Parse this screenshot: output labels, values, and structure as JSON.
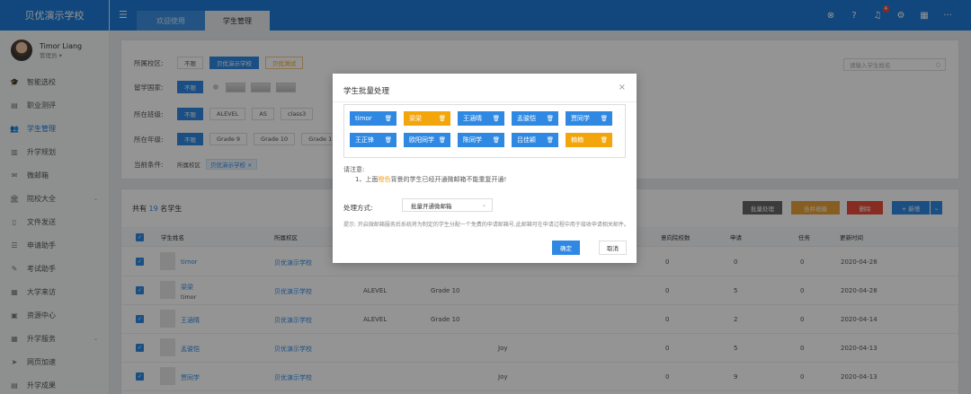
{
  "app": {
    "title": "贝优演示学校"
  },
  "user": {
    "name": "Timor Liang",
    "role": "管理员 ▾"
  },
  "sidebar": {
    "items": [
      {
        "label": "智能选校",
        "icon": "graduation-cap-icon",
        "glyph": "🎓"
      },
      {
        "label": "职业测评",
        "icon": "clipboard-icon",
        "glyph": "▤"
      },
      {
        "label": "学生管理",
        "icon": "users-icon",
        "glyph": "👥",
        "active": true
      },
      {
        "label": "升学规划",
        "icon": "chart-icon",
        "glyph": "▥"
      },
      {
        "label": "微邮箱",
        "icon": "mail-icon",
        "glyph": "✉"
      },
      {
        "label": "院校大全",
        "icon": "bank-icon",
        "glyph": "🏛",
        "caret": "⌄"
      },
      {
        "label": "文件发送",
        "icon": "file-icon",
        "glyph": "▯"
      },
      {
        "label": "申请助手",
        "icon": "list-icon",
        "glyph": "☰"
      },
      {
        "label": "考试助手",
        "icon": "edit-icon",
        "glyph": "✎"
      },
      {
        "label": "大学来访",
        "icon": "calendar-icon",
        "glyph": "▦"
      },
      {
        "label": "资源中心",
        "icon": "briefcase-icon",
        "glyph": "▣"
      },
      {
        "label": "升学服务",
        "icon": "grid-icon",
        "glyph": "▦",
        "caret": "⌄"
      },
      {
        "label": "网页加速",
        "icon": "send-icon",
        "glyph": "➤"
      },
      {
        "label": "升学成果",
        "icon": "table-icon",
        "glyph": "▤"
      }
    ]
  },
  "topbar": {
    "tabs": [
      "欢迎使用",
      "学生管理"
    ],
    "notification_count": "4",
    "icons": [
      "close-circle-icon",
      "help-icon",
      "bell-icon",
      "gear-icon",
      "calendar-icon",
      "more-icon"
    ]
  },
  "filters": {
    "campus_label": "所属校区:",
    "campus_options": [
      "不限",
      "贝优演示学校",
      "贝优测试"
    ],
    "country_label": "留学国家:",
    "country_first": "不限",
    "class_label": "所在班级:",
    "class_options": [
      "不限",
      "ALEVEL",
      "AS",
      "class3"
    ],
    "grade_label": "所在年级:",
    "grade_options": [
      "不限",
      "Grade 9",
      "Grade 10",
      "Grade 1"
    ],
    "condition_label": "当前条件:",
    "condition_prefix": "所属校区",
    "condition_value": "贝优演示学校 ×",
    "search_placeholder": "请输入学生姓名"
  },
  "list": {
    "total_prefix": "共有",
    "total_count": "19",
    "total_suffix": "名学生",
    "actions": {
      "batch": "批量处理",
      "merge": "合并班级",
      "delete": "删除",
      "add": "+ 新增"
    },
    "headers": [
      "学生姓名",
      "所属校区",
      "意向院校数",
      "申请",
      "任务",
      "更新时间"
    ],
    "rows": [
      {
        "name": "timor",
        "sub": "",
        "campus": "贝优演示学校",
        "class": "",
        "grade": "",
        "teacher": "",
        "schools": "0",
        "apply": "0",
        "task": "0",
        "date": "2020-04-28"
      },
      {
        "name": "梁梁",
        "sub": "timor",
        "campus": "贝优演示学校",
        "class": "ALEVEL",
        "grade": "Grade 10",
        "teacher": "",
        "schools": "0",
        "apply": "5",
        "task": "0",
        "date": "2020-04-28"
      },
      {
        "name": "王涵晴",
        "sub": "",
        "campus": "贝优演示学校",
        "class": "ALEVEL",
        "grade": "Grade 10",
        "teacher": "",
        "schools": "0",
        "apply": "2",
        "task": "0",
        "date": "2020-04-14"
      },
      {
        "name": "孟骏恺",
        "sub": "",
        "campus": "贝优演示学校",
        "class": "",
        "grade": "",
        "teacher": "Joy",
        "schools": "0",
        "apply": "5",
        "task": "0",
        "date": "2020-04-13"
      },
      {
        "name": "贾同学",
        "sub": "",
        "campus": "贝优演示学校",
        "class": "",
        "grade": "",
        "teacher": "Joy",
        "schools": "0",
        "apply": "9",
        "task": "0",
        "date": "2020-04-13"
      }
    ]
  },
  "modal": {
    "title": "学生批量处理",
    "close": "×",
    "students": [
      {
        "name": "timor",
        "color": "blue"
      },
      {
        "name": "梁梁",
        "color": "orange"
      },
      {
        "name": "王涵晴",
        "color": "blue"
      },
      {
        "name": "孟骏恺",
        "color": "blue"
      },
      {
        "name": "贾同学",
        "color": "blue"
      },
      {
        "name": "王正锋",
        "color": "blue"
      },
      {
        "name": "欧阳同学",
        "color": "blue"
      },
      {
        "name": "陈同学",
        "color": "blue"
      },
      {
        "name": "吕佳颖",
        "color": "blue"
      },
      {
        "name": "楠楠",
        "color": "orange"
      }
    ],
    "note_title": "请注意:",
    "note_prefix": "1、上面",
    "note_highlight": "橙色",
    "note_suffix": "背景的学生已经开通微邮箱不能重复开通!",
    "process_label": "处理方式:",
    "process_value": "批量开通微邮箱",
    "hint": "提示: 开启微邮箱服务后系统将为制定的学生分配一个免费的申请邮箱号,此邮箱可在申请过程中用于接收申请相关邮件。",
    "ok": "确定",
    "cancel": "取消"
  },
  "colors": {
    "primary": "#2f89e3",
    "topbar": "#1e7bd6",
    "orange": "#f3a50c"
  }
}
